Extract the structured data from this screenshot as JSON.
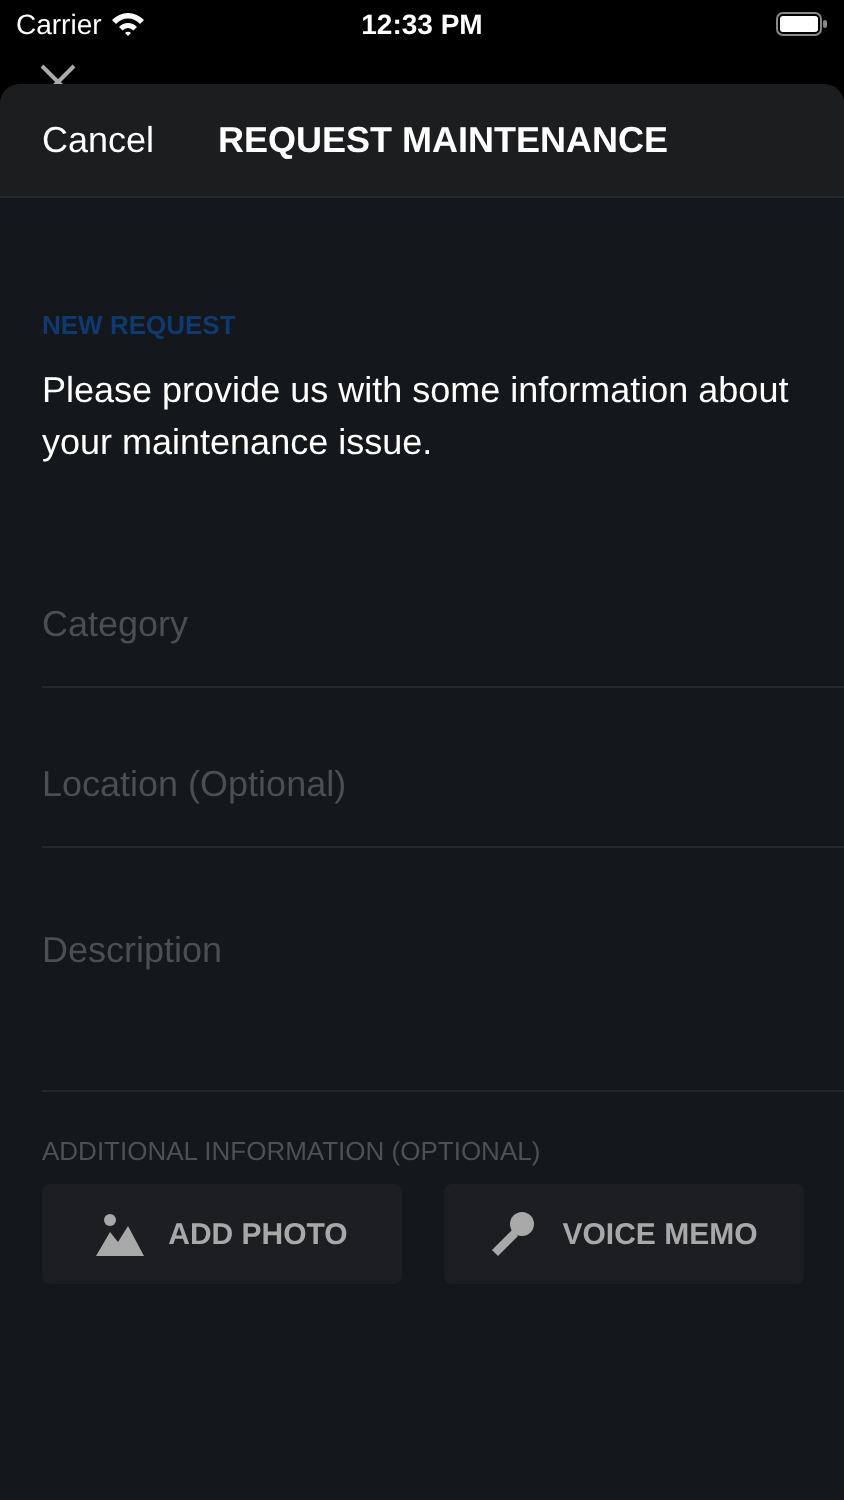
{
  "status_bar": {
    "carrier": "Carrier",
    "time": "12:33 PM"
  },
  "sheet": {
    "cancel": "Cancel",
    "title": "REQUEST MAINTENANCE"
  },
  "section": "NEW REQUEST",
  "intro": "Please provide us with some information about your maintenance issue.",
  "fields": [
    {
      "placeholder": "Category",
      "kind": "line"
    },
    {
      "placeholder": "Location (Optional)",
      "kind": "line"
    },
    {
      "placeholder": "Description",
      "kind": "area"
    }
  ],
  "additional": {
    "label": "ADDITIONAL INFORMATION (OPTIONAL)",
    "buttons": [
      {
        "label": "ADD PHOTO",
        "kind": "photo"
      },
      {
        "label": "VOICE MEMO",
        "kind": "voice"
      }
    ]
  }
}
